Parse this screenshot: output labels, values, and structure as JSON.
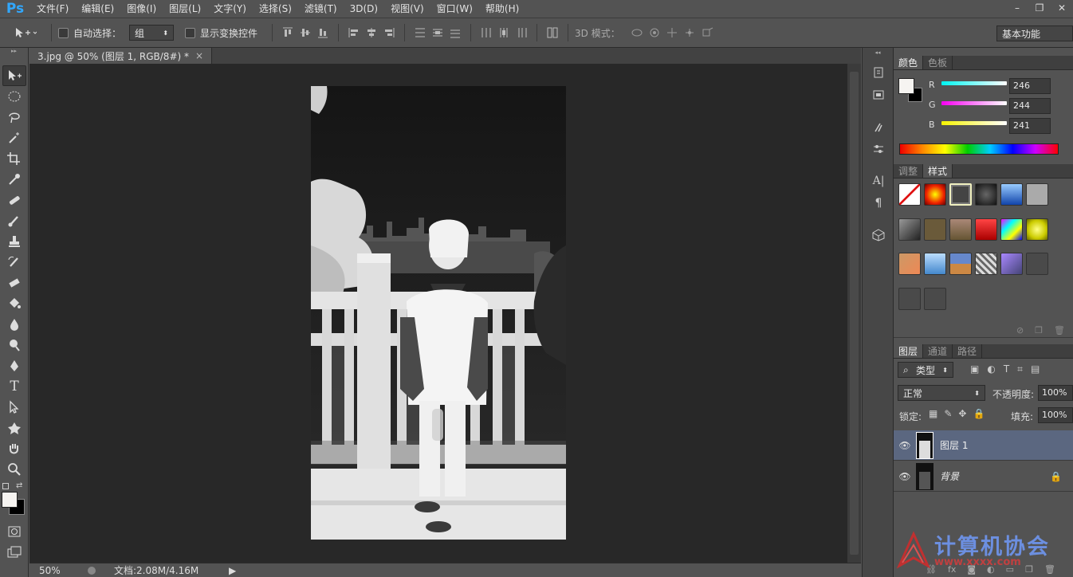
{
  "app": {
    "logo": "Ps"
  },
  "menu": [
    "文件(F)",
    "编辑(E)",
    "图像(I)",
    "图层(L)",
    "文字(Y)",
    "选择(S)",
    "滤镜(T)",
    "3D(D)",
    "视图(V)",
    "窗口(W)",
    "帮助(H)"
  ],
  "window_controls": {
    "minimize": "–",
    "restore": "❐",
    "close": "✕"
  },
  "options": {
    "auto_select_label": "自动选择：",
    "auto_select_value": "组",
    "show_transform_label": "显示变换控件",
    "mode_3d_label": "3D 模式：",
    "workspace": "基本功能"
  },
  "document": {
    "tab_title": "3.jpg @ 50% (图层 1, RGB/8#) *",
    "close": "×",
    "zoom": "50%",
    "doc_info": "文档:2.08M/4.16M"
  },
  "color_panel": {
    "tabs": [
      "颜色",
      "色板"
    ],
    "r_label": "R",
    "r": "246",
    "g_label": "G",
    "g": "244",
    "b_label": "B",
    "b": "241",
    "foreground": "#f6f4f1"
  },
  "styles_panel": {
    "tabs": [
      "调整",
      "样式"
    ]
  },
  "layers_panel": {
    "tabs": [
      "图层",
      "通道",
      "路径"
    ],
    "filter": "类型",
    "blend_mode": "正常",
    "opacity_label": "不透明度:",
    "opacity": "100%",
    "lock_label": "锁定:",
    "fill_label": "填充:",
    "fill": "100%",
    "layers": [
      {
        "name": "图层 1",
        "selected": true
      },
      {
        "name": "背景",
        "locked": true
      }
    ]
  },
  "watermark": {
    "text": "计算机协会",
    "url": "www.xxxx.com"
  }
}
